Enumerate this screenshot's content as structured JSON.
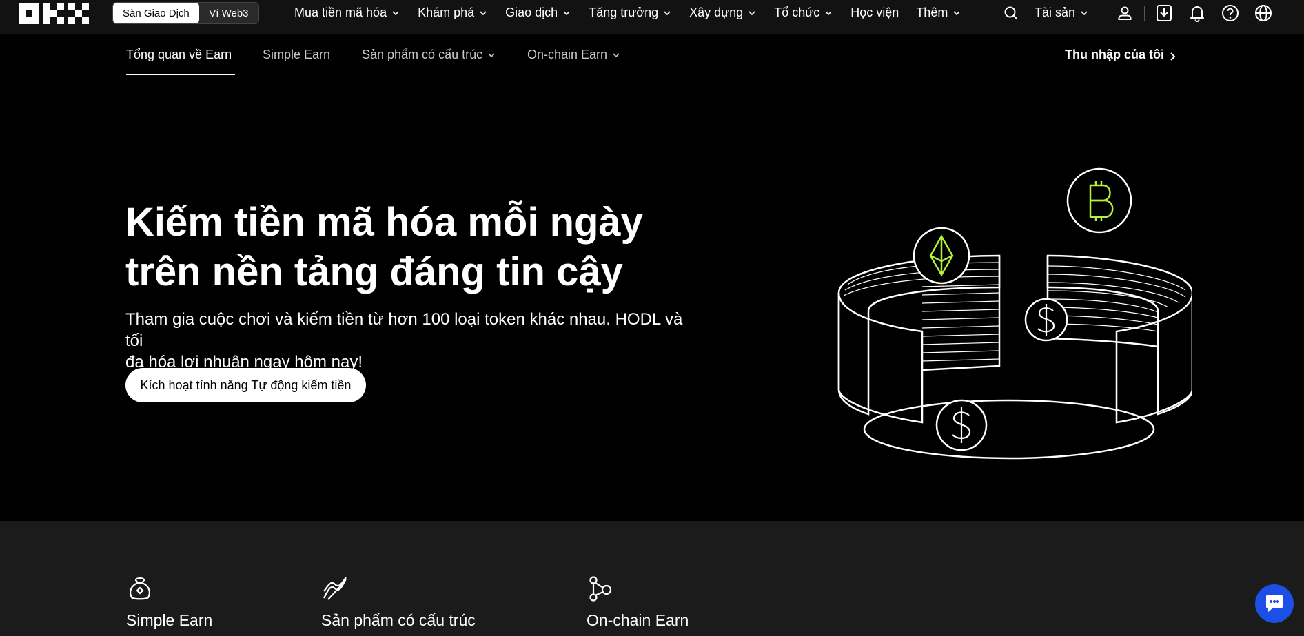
{
  "topnav": {
    "mode_toggle": {
      "active": "Sàn Giao Dịch",
      "inactive": "Ví Web3"
    },
    "menu": [
      {
        "label": "Mua tiền mã hóa",
        "dropdown": true
      },
      {
        "label": "Khám phá",
        "dropdown": true
      },
      {
        "label": "Giao dịch",
        "dropdown": true
      },
      {
        "label": "Tăng trưởng",
        "dropdown": true
      },
      {
        "label": "Xây dựng",
        "dropdown": true
      },
      {
        "label": "Tổ chức",
        "dropdown": true
      },
      {
        "label": "Học viện",
        "dropdown": false
      },
      {
        "label": "Thêm",
        "dropdown": true
      }
    ],
    "assets_label": "Tài sản"
  },
  "subnav": {
    "items": [
      {
        "label": "Tổng quan về Earn",
        "active": true
      },
      {
        "label": "Simple Earn"
      },
      {
        "label": "Sản phẩm có cấu trúc",
        "dropdown": true
      },
      {
        "label": "On-chain Earn",
        "dropdown": true
      }
    ],
    "my_earnings": "Thu nhập của tôi"
  },
  "hero": {
    "title_line1": "Kiếm tiền mã hóa mỗi ngày",
    "title_line2": "trên nền tảng đáng tin cậy",
    "subtitle_line1": "Tham gia cuộc chơi và kiếm tiền từ hơn 100 loại token khác nhau. HODL và tối",
    "subtitle_line2": "đa hóa lợi nhuận ngay hôm nay!",
    "cta": "Kích hoạt tính năng Tự động kiếm tiền",
    "accent_color": "#b6f03a"
  },
  "products": [
    {
      "title": "Simple Earn",
      "icon": "money-bag-icon"
    },
    {
      "title": "Sản phẩm có cấu trúc",
      "icon": "structured-product-icon"
    },
    {
      "title": "On-chain Earn",
      "icon": "network-nodes-icon"
    }
  ]
}
